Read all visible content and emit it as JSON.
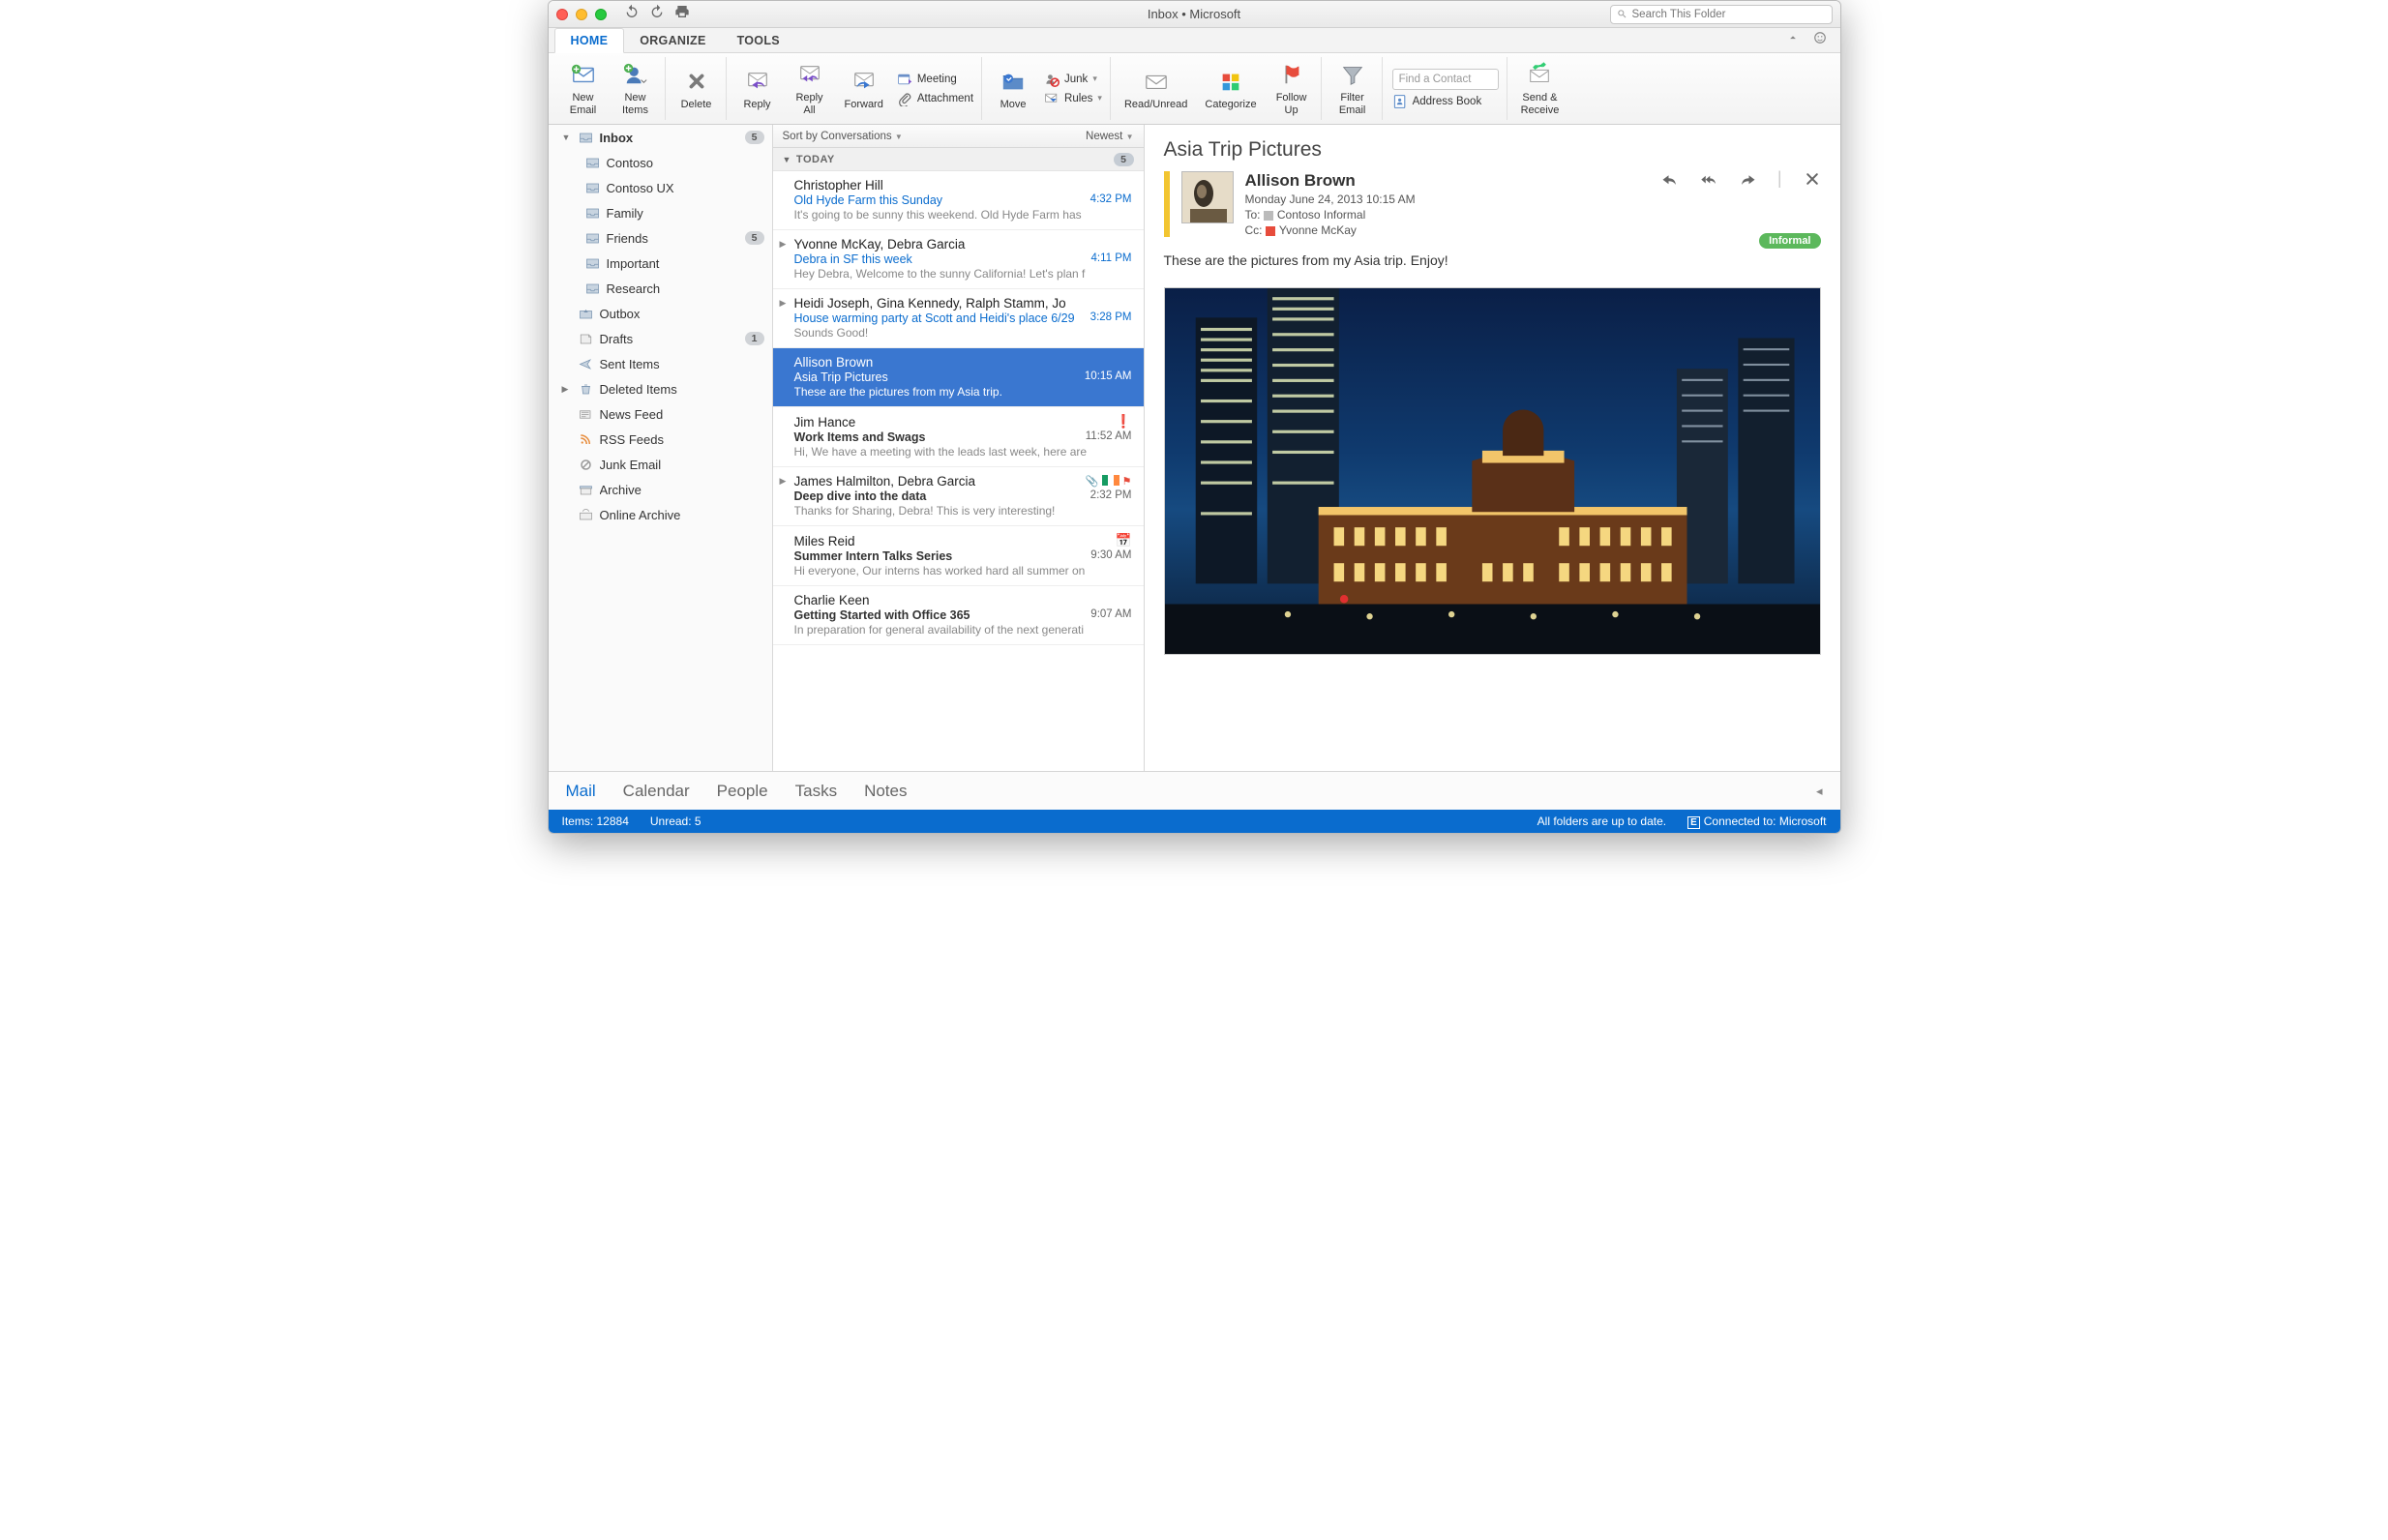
{
  "window": {
    "title": "Inbox • Microsoft"
  },
  "search": {
    "placeholder": "Search This Folder"
  },
  "tabs": {
    "home": "HOME",
    "organize": "ORGANIZE",
    "tools": "TOOLS"
  },
  "ribbon": {
    "new_email": "New\nEmail",
    "new_items": "New\nItems",
    "delete": "Delete",
    "reply": "Reply",
    "reply_all": "Reply\nAll",
    "forward": "Forward",
    "meeting": "Meeting",
    "attachment": "Attachment",
    "move": "Move",
    "junk": "Junk",
    "rules": "Rules",
    "read_unread": "Read/Unread",
    "categorize": "Categorize",
    "follow_up": "Follow\nUp",
    "filter_email": "Filter\nEmail",
    "find_contact_placeholder": "Find a Contact",
    "address_book": "Address Book",
    "send_receive": "Send &\nReceive"
  },
  "sidebar": {
    "inbox": "Inbox",
    "inbox_count": "5",
    "folders": [
      {
        "label": "Contoso"
      },
      {
        "label": "Contoso UX"
      },
      {
        "label": "Family"
      },
      {
        "label": "Friends",
        "count": "5"
      },
      {
        "label": "Important"
      },
      {
        "label": "Research"
      }
    ],
    "outbox": "Outbox",
    "drafts": "Drafts",
    "drafts_count": "1",
    "sent": "Sent Items",
    "deleted": "Deleted Items",
    "news": "News Feed",
    "rss": "RSS Feeds",
    "junk": "Junk Email",
    "archive": "Archive",
    "online_archive": "Online Archive"
  },
  "msglist": {
    "sort": "Sort by Conversations",
    "order": "Newest",
    "today": "TODAY",
    "today_count": "5",
    "items": [
      {
        "from": "Christopher Hill",
        "subject": "Old Hyde Farm this Sunday",
        "time": "4:32 PM",
        "preview": "It's going to be sunny this weekend. Old Hyde Farm has"
      },
      {
        "from": "Yvonne McKay, Debra Garcia",
        "subject": "Debra in SF this week",
        "time": "4:11 PM",
        "preview": "Hey Debra, Welcome to the sunny California! Let's plan f"
      },
      {
        "from": "Heidi Joseph, Gina Kennedy, Ralph Stamm, Jo",
        "subject": "House warming party at Scott and Heidi's place 6/29",
        "time": "3:28 PM",
        "preview": "Sounds Good!"
      },
      {
        "from": "Allison Brown",
        "subject": "Asia Trip Pictures",
        "time": "10:15 AM",
        "preview": "These are the pictures from my Asia trip."
      },
      {
        "from": "Jim Hance",
        "subject": "Work Items and Swags",
        "time": "11:52 AM",
        "preview": "Hi, We have a meeting with the leads last week, here are"
      },
      {
        "from": "James Halmilton, Debra Garcia",
        "subject": "Deep dive into the data",
        "time": "2:32 PM",
        "preview": "Thanks for Sharing, Debra! This is very interesting!"
      },
      {
        "from": "Miles Reid",
        "subject": "Summer Intern Talks Series",
        "time": "9:30 AM",
        "preview": "Hi everyone, Our interns has worked hard all summer on"
      },
      {
        "from": "Charlie Keen",
        "subject": "Getting Started with Office 365",
        "time": "9:07 AM",
        "preview": "In preparation for general availability of the next generati"
      }
    ]
  },
  "reader": {
    "title": "Asia Trip Pictures",
    "sender": "Allison Brown",
    "date": "Monday June 24, 2013 10:15 AM",
    "to_label": "To:",
    "to": "Contoso Informal",
    "cc_label": "Cc:",
    "cc": "Yvonne McKay",
    "tag": "Informal",
    "body": "These are the pictures from my Asia trip.   Enjoy!"
  },
  "bottomnav": {
    "mail": "Mail",
    "calendar": "Calendar",
    "people": "People",
    "tasks": "Tasks",
    "notes": "Notes"
  },
  "status": {
    "items": "Items: 12884",
    "unread": "Unread: 5",
    "sync": "All folders are up to date.",
    "connected": "Connected to: Microsoft"
  }
}
